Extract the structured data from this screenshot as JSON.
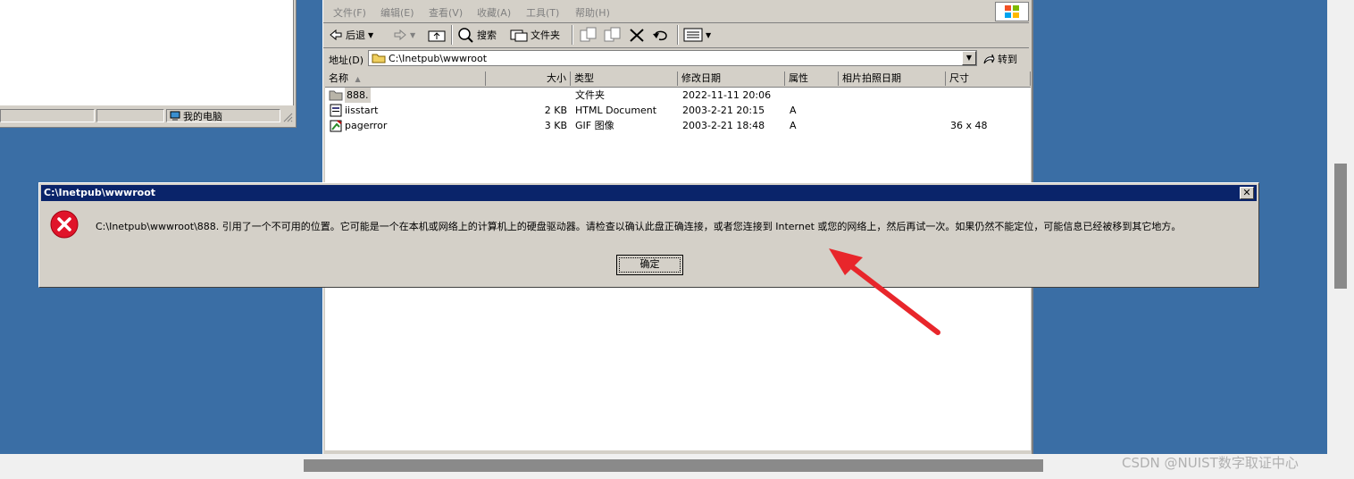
{
  "left_window": {
    "status_computer": "我的电脑"
  },
  "explorer": {
    "menu": [
      "文件(F)",
      "编辑(E)",
      "查看(V)",
      "收藏(A)",
      "工具(T)",
      "帮助(H)"
    ],
    "toolbar": {
      "back_label": "后退",
      "search_label": "搜索",
      "folders_label": "文件夹"
    },
    "address": {
      "label": "地址(D)",
      "value": "C:\\Inetpub\\wwwroot",
      "go_label": "转到"
    },
    "columns": {
      "name": "名称",
      "size": "大小",
      "type": "类型",
      "modified": "修改日期",
      "attributes": "属性",
      "photo_date": "相片拍照日期",
      "dimensions": "尺寸"
    },
    "files": [
      {
        "name": "888.",
        "size": "",
        "type": "文件夹",
        "modified": "2022-11-11 20:06",
        "attr": "",
        "dims": ""
      },
      {
        "name": "iisstart",
        "size": "2 KB",
        "type": "HTML Document",
        "modified": "2003-2-21 20:15",
        "attr": "A",
        "dims": ""
      },
      {
        "name": "pagerror",
        "size": "3 KB",
        "type": "GIF 图像",
        "modified": "2003-2-21 18:48",
        "attr": "A",
        "dims": "36 x 48"
      }
    ]
  },
  "dialog": {
    "title": "C:\\Inetpub\\wwwroot",
    "message": "C:\\Inetpub\\wwwroot\\888. 引用了一个不可用的位置。它可能是一个在本机或网络上的计算机上的硬盘驱动器。请检查以确认此盘正确连接，或者您连接到 Internet 或您的网络上，然后再试一次。如果仍然不能定位，可能信息已经被移到其它地方。",
    "ok_label": "确定"
  },
  "watermark": "CSDN @NUIST数字取证中心",
  "colors": {
    "desktop": "#3a6ea5",
    "titlebar": "#0a246a",
    "annotation_arrow": "#e8262b",
    "error_icon": "#e0142a"
  }
}
